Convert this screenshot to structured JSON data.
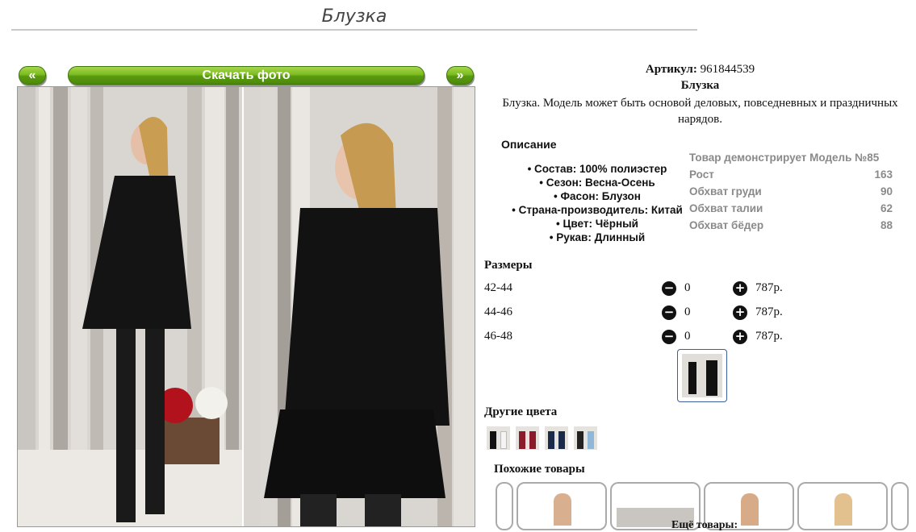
{
  "page": {
    "title": "Блузка"
  },
  "gallery": {
    "prev_label": "«",
    "next_label": "»",
    "download_label": "Скачать фото"
  },
  "product": {
    "article_label": "Артикул:",
    "article_value": "961844539",
    "name": "Блузка",
    "description": "Блузка. Модель может быть основой деловых, повседневных и праздничных нарядов."
  },
  "description_section": {
    "title": "Описание",
    "properties": [
      "Состав: 100% полиэстер",
      "Сезон: Весна-Осень",
      "Фасон: Блузон",
      "Страна-производитель: Китай",
      "Цвет: Чёрный",
      "Рукав: Длинный"
    ]
  },
  "model": {
    "header": "Товар демонстрирует Модель №85",
    "rows": [
      {
        "label": "Рост",
        "value": "163"
      },
      {
        "label": "Обхват груди",
        "value": "90"
      },
      {
        "label": "Обхват талии",
        "value": "62"
      },
      {
        "label": "Обхват бёдер",
        "value": "88"
      }
    ]
  },
  "sizes": {
    "title": "Размеры",
    "rows": [
      {
        "size": "42-44",
        "qty": "0",
        "price": "787р."
      },
      {
        "size": "44-46",
        "qty": "0",
        "price": "787р."
      },
      {
        "size": "46-48",
        "qty": "0",
        "price": "787р."
      }
    ]
  },
  "other_colors": {
    "title": "Другие цвета"
  },
  "similar": {
    "title": "Похожие товары"
  },
  "more": {
    "title": "Ещё товары:"
  },
  "colors": {
    "accent": "#6aab18",
    "border": "#3b5f9a"
  }
}
